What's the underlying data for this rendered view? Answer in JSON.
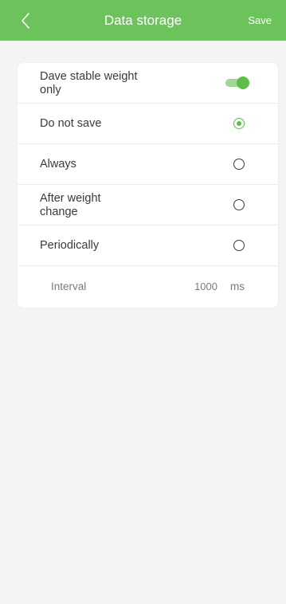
{
  "header": {
    "title": "Data storage",
    "save_label": "Save",
    "background_color": "#6cc35c"
  },
  "settings": {
    "stable_weight": {
      "label": "Dave stable weight only",
      "enabled": true
    },
    "options": [
      {
        "label": "Do not save",
        "selected": true
      },
      {
        "label": "Always",
        "selected": false
      },
      {
        "label": "After weight change",
        "selected": false
      },
      {
        "label": "Periodically",
        "selected": false
      }
    ],
    "interval": {
      "label": "Interval",
      "value": "1000",
      "unit": "ms"
    },
    "accent_color": "#5cbd4a"
  },
  "icons": {
    "back": "chevron-left-icon"
  }
}
